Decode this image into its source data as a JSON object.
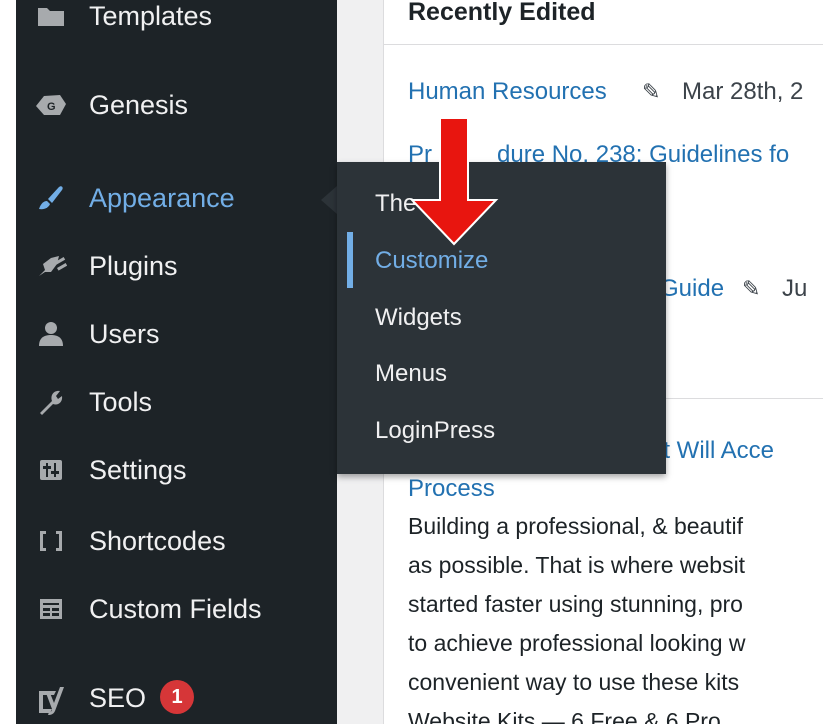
{
  "sidebar": {
    "items": [
      {
        "label": "Templates",
        "icon": "templates-icon"
      },
      {
        "label": "Genesis",
        "icon": "genesis-icon"
      },
      {
        "label": "Appearance",
        "icon": "paintbrush-icon"
      },
      {
        "label": "Plugins",
        "icon": "plug-icon"
      },
      {
        "label": "Users",
        "icon": "user-icon"
      },
      {
        "label": "Tools",
        "icon": "wrench-icon"
      },
      {
        "label": "Settings",
        "icon": "sliders-icon"
      },
      {
        "label": "Shortcodes",
        "icon": "brackets-icon"
      },
      {
        "label": "Custom Fields",
        "icon": "grid-icon"
      },
      {
        "label": "SEO",
        "icon": "yoast-icon",
        "badge": "1"
      }
    ]
  },
  "flyout": {
    "items": [
      {
        "label": "The"
      },
      {
        "label": "Customize"
      },
      {
        "label": "Widgets"
      },
      {
        "label": "Menus"
      },
      {
        "label": "LoginPress"
      }
    ]
  },
  "content": {
    "title": "Recently Edited",
    "entries": [
      {
        "link": "Human Resources",
        "date": "Mar 28th, 2"
      },
      {
        "link_part1": "Pr",
        "link_part2": "dure No. 238: Guidelines fo"
      },
      {
        "link": "Guide",
        "date": "Ju"
      }
    ],
    "article": {
      "title_tail": "at Will Acce",
      "title_line2": "Process",
      "lines": [
        "Building a professional, & beautif",
        "as possible. That is where websit",
        "started faster using stunning, pro",
        "to achieve professional looking w",
        "convenient way to use these kits",
        "Website Kits — 6 Free & 6 Pro"
      ]
    }
  },
  "colors": {
    "sidebar_bg": "#1d2327",
    "flyout_bg": "#2c3338",
    "accent": "#72aee6",
    "link": "#2271b1",
    "badge": "#d63638",
    "annotation_arrow": "#e8150f"
  }
}
